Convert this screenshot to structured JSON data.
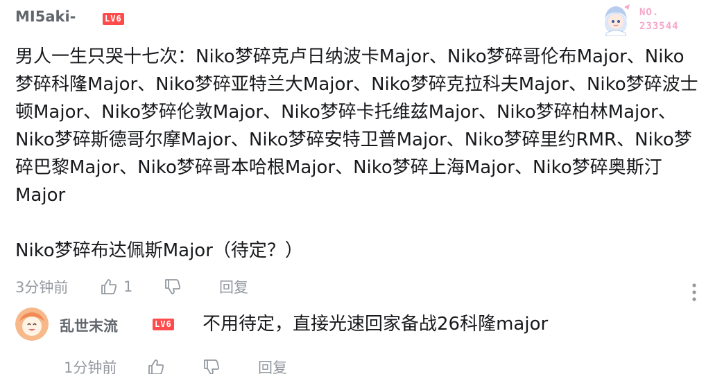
{
  "comment": {
    "username": "MI5aki-",
    "level_badge": "LV6",
    "fan_badge": {
      "label_line1": "NO.",
      "label_line2": "233544"
    },
    "text": "男人一生只哭十七次：Niko梦碎克卢日纳波卡Major、Niko梦碎哥伦布Major、Niko梦碎科隆Major、Niko梦碎亚特兰大Major、Niko梦碎克拉科夫Major、Niko梦碎波士顿Major、Niko梦碎伦敦Major、Niko梦碎卡托维兹Major、Niko梦碎柏林Major、Niko梦碎斯德哥尔摩Major、Niko梦碎安特卫普Major、Niko梦碎里约RMR、Niko梦碎巴黎Major、Niko梦碎哥本哈根Major、Niko梦碎上海Major、Niko梦碎奥斯汀Major",
    "text_tail": "Niko梦碎布达佩斯Major（待定？）",
    "time": "3分钟前",
    "like_count": "1",
    "reply_label": "回复"
  },
  "reply": {
    "username": "乱世末流",
    "level_badge": "LV6",
    "text": "不用待定，直接光速回家备战26科隆major",
    "time": "1分钟前",
    "reply_label": "回复"
  },
  "colors": {
    "level_badge": "#ff4b4b",
    "meta_text": "#9499a0",
    "username": "#61666d",
    "fan_badge_text": "#f6a7c9"
  },
  "icons": {
    "like": "thumbs-up-icon",
    "dislike": "thumbs-down-icon",
    "more": "vertical-ellipsis-icon"
  }
}
